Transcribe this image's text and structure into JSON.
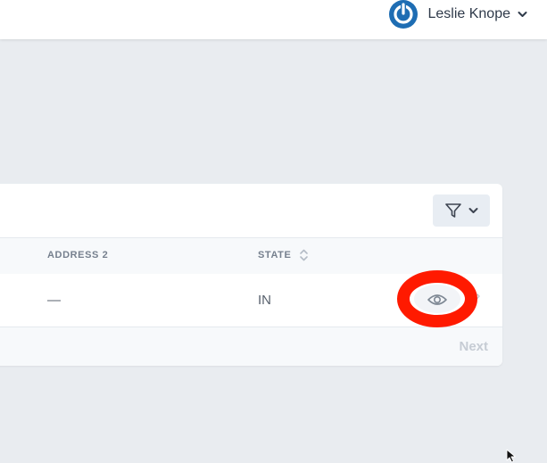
{
  "header": {
    "user_name": "Leslie Knope",
    "avatar_icon": "power-icon",
    "avatar_color": "#1e6db3"
  },
  "table": {
    "filter_icon": "filter-icon",
    "columns": [
      "ADDRESS 2",
      "STATE"
    ],
    "rows": [
      {
        "address2": "—",
        "state": "IN"
      }
    ],
    "row_action_icon": "eye-icon",
    "highlight_color": "#ff1a00"
  },
  "pagination": {
    "next_label": "Next"
  }
}
